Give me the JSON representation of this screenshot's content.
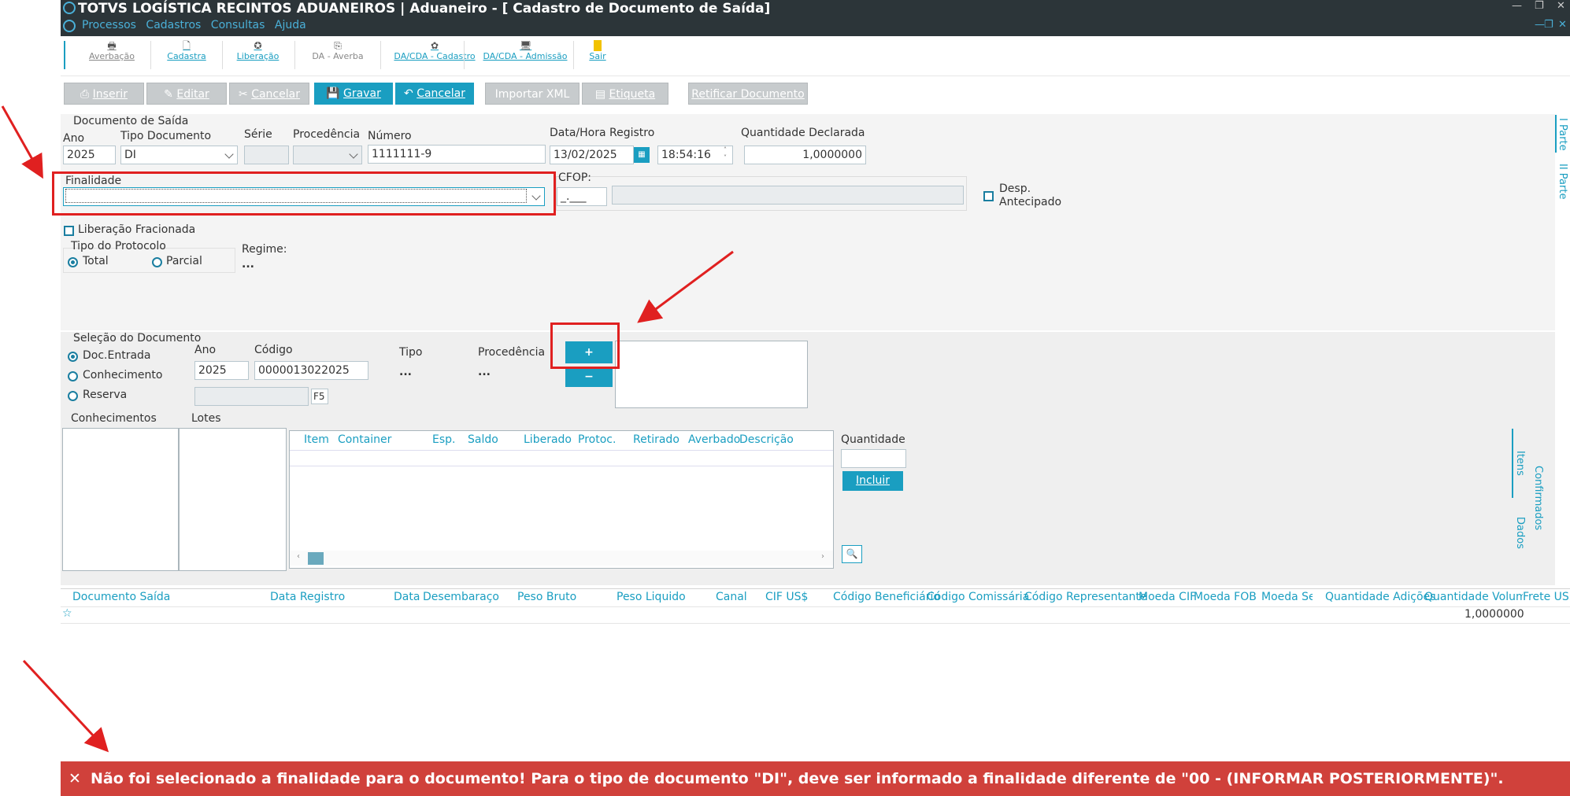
{
  "window": {
    "title": "TOTVS LOGÍSTICA RECINTOS ADUANEIROS | Aduaneiro - [ Cadastro de Documento de Saída]",
    "menu": [
      "Processos",
      "Cadastros",
      "Consultas",
      "Ajuda"
    ]
  },
  "toolbar": [
    {
      "label": "Averbação",
      "icon": "printer-icon"
    },
    {
      "label": "Cadastra",
      "icon": "document-icon"
    },
    {
      "label": "Liberação",
      "icon": "seal-icon"
    },
    {
      "label": "DA - Averba",
      "icon": "stamp-icon"
    },
    {
      "label": "DA/CDA - Cadastro",
      "icon": "palette-icon"
    },
    {
      "label": "DA/CDA - Admissão",
      "icon": "monitor-icon"
    },
    {
      "label": "Sair",
      "icon": "exit-door-icon"
    }
  ],
  "actions": {
    "inserir": "Inserir",
    "editar": "Editar",
    "cancelar1": "Cancelar",
    "gravar": "Gravar",
    "cancelar2": "Cancelar",
    "importar_xml": "Importar XML",
    "etiqueta": "Etiqueta",
    "retificar": "Retificar Documento"
  },
  "doc_saida": {
    "group_title": "Documento de Saída",
    "ano_label": "Ano",
    "ano": "2025",
    "tipo_label": "Tipo Documento",
    "tipo": "DI",
    "serie_label": "Série",
    "procedencia_label": "Procedência",
    "numero_label": "Número",
    "numero": "1111111-9",
    "data_label": "Data/Hora Registro",
    "data": "13/02/2025",
    "hora": "18:54:16",
    "qtd_label": "Quantidade Declarada",
    "qtd": "1,0000000",
    "finalidade_label": "Finalidade",
    "finalidade": "",
    "cfop_label": "CFOP:",
    "cfop": "_.___",
    "desp_label1": "Desp.",
    "desp_label2": "Antecipado",
    "lib_frac_label": "Liberação Fracionada",
    "tipo_protocolo_label": "Tipo do Protocolo",
    "total_label": "Total",
    "parcial_label": "Parcial",
    "regime_label": "Regime:",
    "regime": "..."
  },
  "selecao": {
    "group_title": "Seleção do Documento",
    "doc_entrada": "Doc.Entrada",
    "conhecimento": "Conhecimento",
    "reserva": "Reserva",
    "ano_label": "Ano",
    "ano": "2025",
    "codigo_label": "Código",
    "codigo": "0000013022025",
    "tipo_label": "Tipo",
    "tipo": "...",
    "procedencia_label": "Procedência",
    "procedencia": "...",
    "f5": "F5",
    "plus": "+",
    "minus": "−"
  },
  "lists": {
    "conhecimentos": "Conhecimentos",
    "lotes": "Lotes"
  },
  "items_table": {
    "columns": [
      "Item",
      "Container",
      "Esp.",
      "Saldo",
      "Liberado",
      "Protoc.",
      "Retirado",
      "Averbado",
      "Descrição"
    ],
    "quantidade_label": "Quantidade",
    "incluir": "Incluir"
  },
  "side_tabs": {
    "parte1": "I Parte",
    "parte2": "II Parte",
    "itens": "Itens",
    "dados": "Dados",
    "confirmados": "Confirmados"
  },
  "grid": {
    "columns": [
      "Documento Saída",
      "Data Registro",
      "Data",
      "Desembaraço",
      "Peso Bruto",
      "Peso Liquido",
      "Canal",
      "CIF US$",
      "Código Beneficiário",
      "Código Comissária",
      "Código Representante",
      "Moeda CIF",
      "Moeda FOB",
      "Moeda Seguro",
      "Quantidade Adições",
      "Quantidade Volumes",
      "Frete US$"
    ],
    "row_qtd": "1,0000000"
  },
  "error_message": "Não foi selecionado a finalidade para o documento! Para o tipo de documento \"DI\", deve ser informado a finalidade diferente de \"00 - (INFORMAR POSTERIORMENTE)\".",
  "colors": {
    "accent": "#1a9ec1",
    "error": "#d0413b",
    "annotation": "#e02020",
    "titlebar": "#2c3539"
  }
}
